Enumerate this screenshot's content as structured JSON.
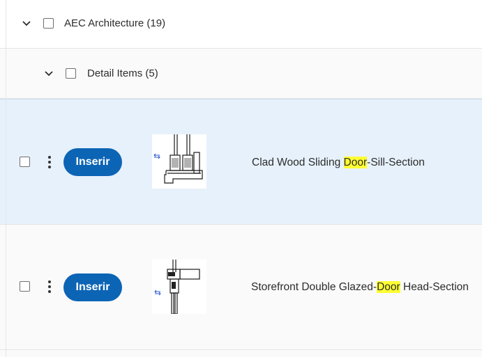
{
  "group": {
    "label": "AEC Architecture",
    "count": "(19)",
    "expand_icon": "chevron-down-icon"
  },
  "subgroup": {
    "label": "Detail Items",
    "count": "(5)",
    "expand_icon": "chevron-down-icon"
  },
  "items": [
    {
      "insert_label": "Inserir",
      "name_before": "Clad Wood Sliding ",
      "name_highlight": "Door",
      "name_after": "-Sill-Section",
      "selected": true,
      "thumbnail_icon": "sill-section-drawing"
    },
    {
      "insert_label": "Inserir",
      "name_before": "Storefront Double Glazed-",
      "name_highlight": "Door",
      "name_after": " Head-Section",
      "selected": false,
      "thumbnail_icon": "head-section-drawing"
    }
  ],
  "colors": {
    "accent": "#0c64b5",
    "selected_row": "#e7f1fb",
    "highlight": "#ffff33"
  }
}
